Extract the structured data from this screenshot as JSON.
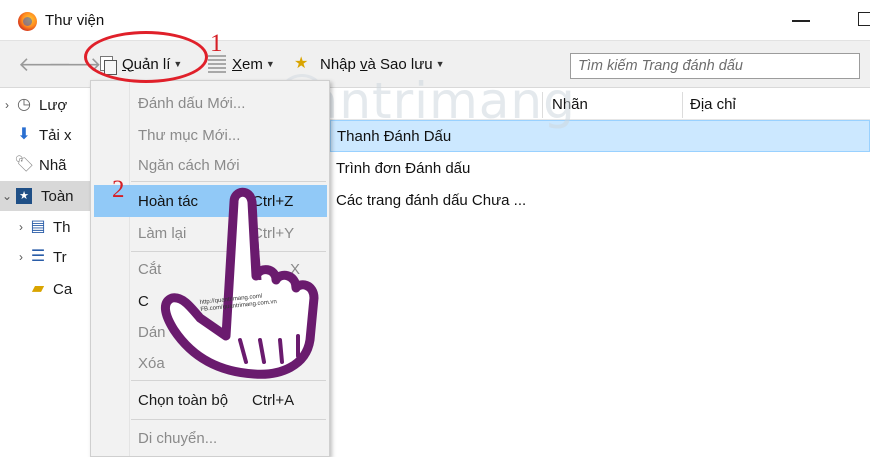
{
  "window": {
    "title": "Thư viện"
  },
  "toolbar": {
    "organize": {
      "pre": "",
      "ul": "Q",
      "post": "uản lí"
    },
    "views": {
      "ul": "X",
      "post": "em"
    },
    "import": {
      "pre": "Nhập ",
      "ul": "v",
      "post": "à Sao lưu"
    },
    "search_placeholder": "Tìm kiếm Trang đánh dấu"
  },
  "annotations": {
    "step1": "1",
    "step2": "2"
  },
  "sidebar": {
    "items": [
      {
        "label": "Lượ",
        "icon": "history-icon",
        "chevron": "›"
      },
      {
        "label": "Tải x",
        "icon": "download-icon",
        "chevron": ""
      },
      {
        "label": "Nhã",
        "icon": "tag-icon",
        "chevron": ""
      },
      {
        "label": "Toàn",
        "icon": "bookmarks-star-icon",
        "chevron": "⌄"
      },
      {
        "label": "Th",
        "icon": "toolbar-folder-icon",
        "chevron": "›"
      },
      {
        "label": "Tr",
        "icon": "menu-folder-icon",
        "chevron": "›"
      },
      {
        "label": "Ca",
        "icon": "unsorted-folder-icon",
        "chevron": ""
      }
    ]
  },
  "columns": {
    "name": "",
    "tags": "Nhãn",
    "location": "Địa chỉ"
  },
  "rows": [
    {
      "name": "Thanh Đánh Dấu"
    },
    {
      "name": "Trình đơn Đánh dấu"
    },
    {
      "name": "Các trang đánh dấu Chưa ..."
    }
  ],
  "menu": {
    "items": [
      {
        "label": "Đánh dấu Mới...",
        "shortcut": "",
        "disabled": true
      },
      {
        "label": "Thư mục Mới...",
        "shortcut": "",
        "disabled": true
      },
      {
        "label": "Ngăn cách Mới",
        "shortcut": "",
        "disabled": true
      },
      {
        "label": "Hoàn tác",
        "shortcut": "Ctrl+Z",
        "disabled": false
      },
      {
        "label": "Làm lại",
        "shortcut": "Ctrl+Y",
        "disabled": true
      },
      {
        "label": "Cắt",
        "shortcut": "X",
        "disabled": true
      },
      {
        "label": "C",
        "shortcut": "",
        "disabled": false
      },
      {
        "label": "Dán",
        "shortcut": "V",
        "disabled": true
      },
      {
        "label": "Xóa",
        "shortcut": "",
        "disabled": true
      },
      {
        "label": "Chọn toàn bộ",
        "shortcut": "Ctrl+A",
        "disabled": false
      },
      {
        "label": "Di chuyển...",
        "shortcut": "",
        "disabled": true
      }
    ]
  },
  "watermark": {
    "text": "uantrimang",
    "url1": "http://quantrimang.com/",
    "url2": "FB.com/quantrimang.com.vn"
  },
  "colors": {
    "highlight": "#91c9f7",
    "selected_row": "#cce8ff",
    "annotation": "#e0202a"
  }
}
